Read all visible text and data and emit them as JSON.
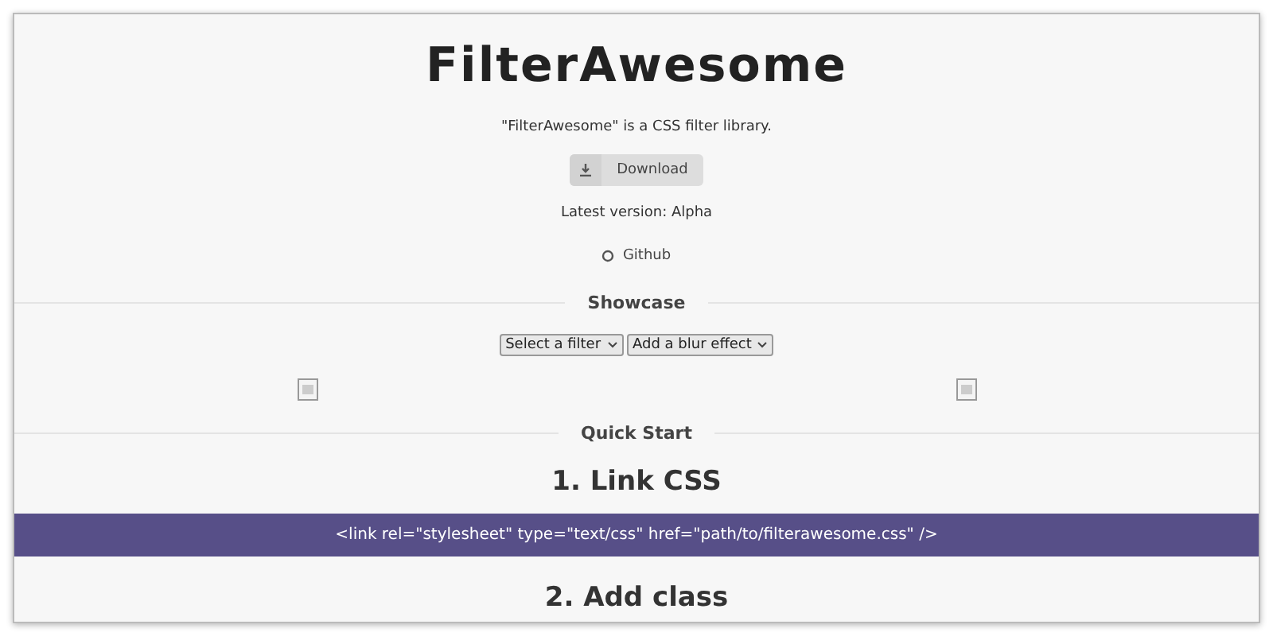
{
  "title": "FilterAwesome",
  "tagline": "\"FilterAwesome\" is a CSS filter library.",
  "download_button": "Download",
  "version": "Latest version: Alpha",
  "github_link": "Github",
  "sections": [
    {
      "kind": "showcase",
      "heading": "Showcase",
      "selects": [
        "Select a filter",
        "Add a blur effect"
      ]
    },
    {
      "kind": "quickstart",
      "heading": "Quick Start",
      "steps": [
        {
          "heading": "1. Link CSS",
          "code": "<link rel=\"stylesheet\" type=\"text/css\" href=\"path/to/filterawesome.css\" />"
        },
        {
          "heading": "2. Add class"
        }
      ]
    }
  ]
}
